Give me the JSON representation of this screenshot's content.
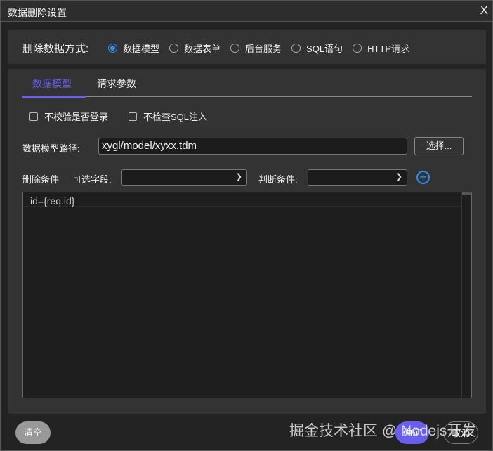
{
  "window": {
    "title": "数据删除设置",
    "close": "X"
  },
  "method": {
    "label": "删除数据方式:",
    "options": [
      "数据模型",
      "数据表单",
      "后台服务",
      "SQL语句",
      "HTTP请求"
    ],
    "selected": "数据模型"
  },
  "tabs": [
    "数据模型",
    "请求参数"
  ],
  "checkboxes": [
    "不校验是否登录",
    "不检查SQL注入"
  ],
  "path": {
    "label": "数据模型路径:",
    "value": "xygl/model/xyxx.tdm",
    "button": "选择..."
  },
  "condition": {
    "label": "删除条件",
    "field_label": "可选字段:",
    "judge_label": "判断条件:",
    "field_value": "",
    "judge_value": ""
  },
  "editor": {
    "code": "id={req.id}"
  },
  "footer": {
    "clear": "清空",
    "ok": "确定",
    "cancel": "取消"
  },
  "watermark": "掘金技术社区 @ Nodejs开发",
  "colors": {
    "accent": "#6a5ef0",
    "radio": "#2d8cf0"
  }
}
